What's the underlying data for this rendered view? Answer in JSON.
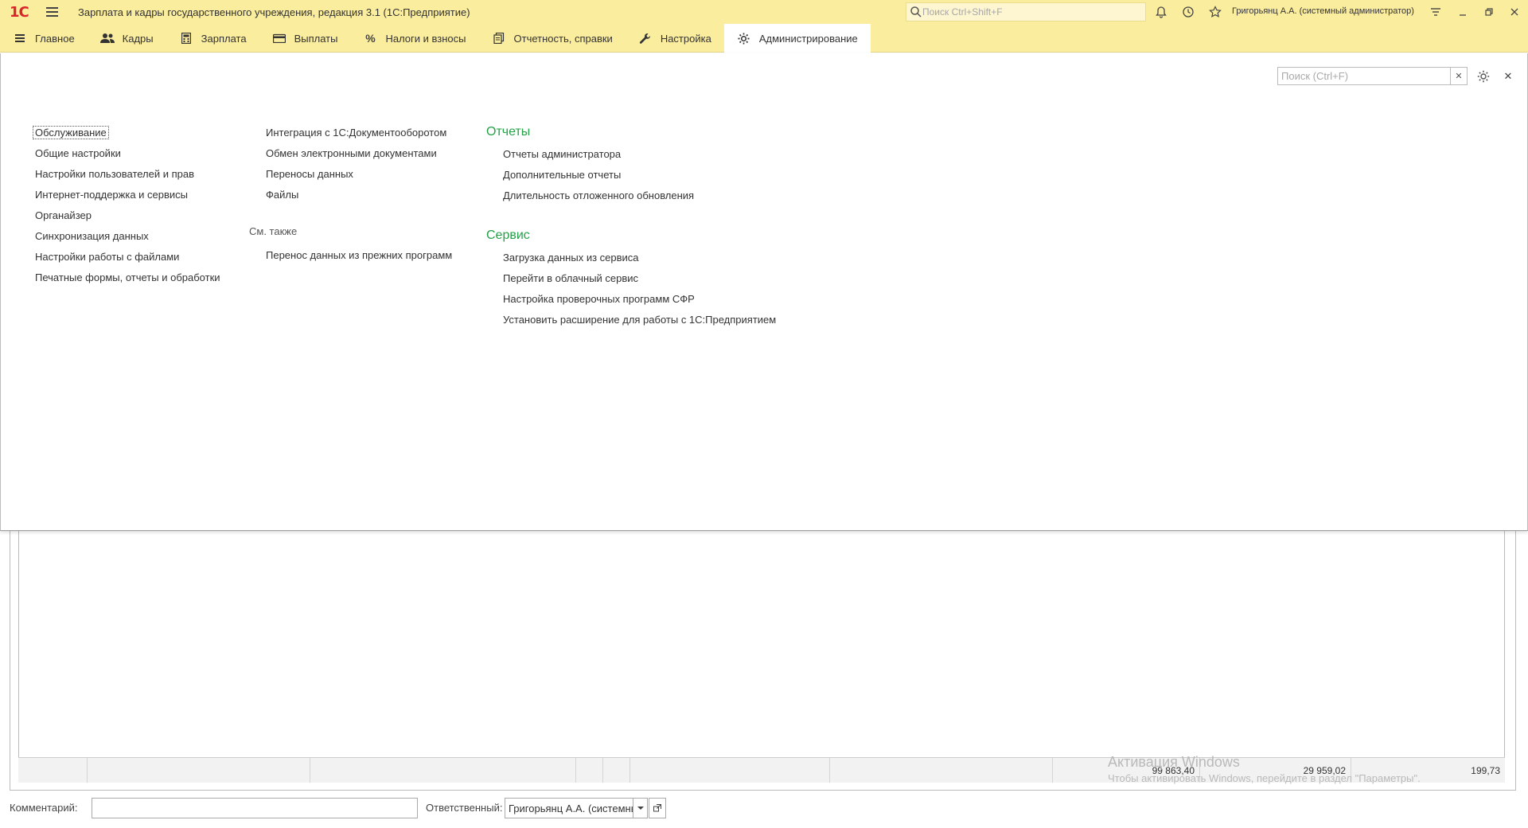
{
  "titlebar": {
    "logo_text": "1С",
    "app_title": "Зарплата и кадры государственного учреждения, редакция 3.1  (1С:Предприятие)",
    "search_placeholder": "Поиск Ctrl+Shift+F",
    "user": "Григорьянц А.А. (системный администратор)",
    "icons": [
      "bell-icon",
      "history-icon",
      "star-icon",
      "settings-menu-icon",
      "minimize-icon",
      "restore-icon",
      "close-icon"
    ]
  },
  "sections": [
    {
      "label": "Главное",
      "icon": "menu-icon"
    },
    {
      "label": "Кадры",
      "icon": "people-icon"
    },
    {
      "label": "Зарплата",
      "icon": "calculator-icon"
    },
    {
      "label": "Выплаты",
      "icon": "wallet-icon"
    },
    {
      "label": "Налоги и взносы",
      "icon": "percent-icon"
    },
    {
      "label": "Отчетность, справки",
      "icon": "documents-icon"
    },
    {
      "label": "Настройка",
      "icon": "wrench-icon"
    },
    {
      "label": "Администрирование",
      "icon": "gear-icon",
      "active": true
    }
  ],
  "panel": {
    "search_placeholder": "Поиск (Ctrl+F)",
    "col1": [
      "Обслуживание",
      "Общие настройки",
      "Настройки пользователей и прав",
      "Интернет-поддержка и сервисы",
      "Органайзер",
      "Синхронизация данных",
      "Настройки работы с файлами",
      "Печатные формы, отчеты и обработки"
    ],
    "col2": [
      "Интеграция с 1С:Документооборотом",
      "Обмен электронными документами",
      "Переносы данных",
      "Файлы"
    ],
    "see_also_label": "См. также",
    "see_also": [
      "Перенос данных из прежних программ"
    ],
    "reports_head": "Отчеты",
    "reports": [
      "Отчеты администратора",
      "Дополнительные отчеты",
      "Длительность отложенного обновления"
    ],
    "service_head": "Сервис",
    "service": [
      "Загрузка данных из сервиса",
      "Перейти в облачный сервис",
      "Настройка проверочных программ СФР",
      "Установить расширение для работы с 1С:Предприятием"
    ]
  },
  "totals": {
    "total1": "99 863,40",
    "total2": "29 959,02",
    "total3": "199,73"
  },
  "watermark": {
    "line1": "Активация Windows",
    "line2": "Чтобы активировать Windows, перейдите в раздел \"Параметры\"."
  },
  "footer": {
    "comment_label": "Комментарий:",
    "comment_value": "",
    "responsible_label": "Ответственный:",
    "responsible_value": "Григорьянц А.А. (системный администратор)"
  }
}
